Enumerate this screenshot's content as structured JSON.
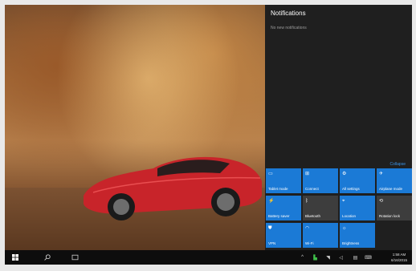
{
  "action_center": {
    "title": "Notifications",
    "subtitle": "No new notifications",
    "collapse_label": "Collapse",
    "tiles": [
      {
        "label": "Tablet mode",
        "icon": "▭",
        "on": true
      },
      {
        "label": "Connect",
        "icon": "⊞",
        "on": true
      },
      {
        "label": "All settings",
        "icon": "⚙",
        "on": true
      },
      {
        "label": "Airplane mode",
        "icon": "✈",
        "on": true
      },
      {
        "label": "Battery saver",
        "icon": "⚡",
        "on": true
      },
      {
        "label": "Bluetooth",
        "icon": "ᛒ",
        "on": false
      },
      {
        "label": "Location",
        "icon": "⌖",
        "on": true
      },
      {
        "label": "Rotation lock",
        "icon": "⟲",
        "on": false
      },
      {
        "label": "VPN",
        "icon": "⛊",
        "on": true
      },
      {
        "label": "Wi-Fi",
        "icon": "◠",
        "on": true
      },
      {
        "label": "Brightness",
        "icon": "☼",
        "on": true
      }
    ]
  },
  "taskbar": {
    "clock_time": "1:58 AM",
    "clock_date": "6/16/2015"
  },
  "colors": {
    "accent": "#1b7ad6",
    "panel": "#1f1f1f",
    "taskbar": "#0d0d0d"
  }
}
